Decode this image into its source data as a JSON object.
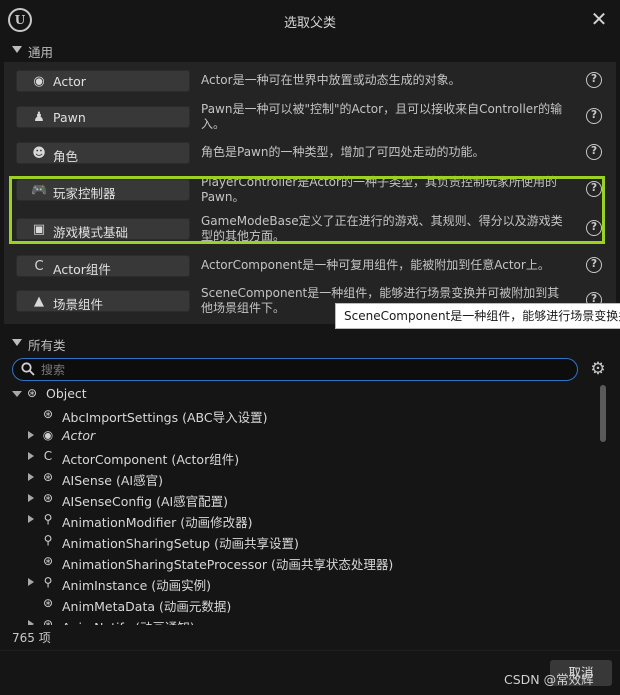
{
  "window": {
    "title": "选取父类",
    "close_glyph": "✕"
  },
  "common": {
    "header": "通用",
    "items": [
      {
        "icon": "actor-icon",
        "label": "Actor",
        "desc": "Actor是一种可在世界中放置或动态生成的对象。"
      },
      {
        "icon": "pawn-icon",
        "label": "Pawn",
        "desc": "Pawn是一种可以被\"控制\"的Actor，且可以接收来自Controller的输入。"
      },
      {
        "icon": "character-icon",
        "label": "角色",
        "desc": "角色是Pawn的一种类型，增加了可四处走动的功能。"
      },
      {
        "icon": "gamepad-icon",
        "label": "玩家控制器",
        "desc": "PlayerController是Actor的一种子类型，其负责控制玩家所使用的Pawn。"
      },
      {
        "icon": "game-mode-icon",
        "label": "游戏模式基础",
        "desc": "GameModeBase定义了正在进行的游戏、其规则、得分以及游戏类型的其他方面。"
      },
      {
        "icon": "component-icon",
        "label": "Actor组件",
        "desc": "ActorComponent是一种可复用组件，能被附加到任意Actor上。"
      },
      {
        "icon": "scene-component-icon",
        "label": "场景组件",
        "desc": "SceneComponent是一种组件，能够进行场景变换并可被附加到其他场景组件下。"
      }
    ]
  },
  "tooltip": {
    "text": "SceneComponent是一种组件，能够进行场景变换并可被附加到其他场景组件下。"
  },
  "all_classes": {
    "header": "所有类",
    "search_placeholder": "搜索",
    "tree": [
      {
        "label": "Object",
        "icon": "object-icon",
        "expanded": true,
        "has_children": true,
        "italic": false
      },
      {
        "label": "AbcImportSettings (ABC导入设置)",
        "icon": "object-icon",
        "has_children": false,
        "italic": false
      },
      {
        "label": "Actor",
        "icon": "actor-icon",
        "has_children": true,
        "italic": true
      },
      {
        "label": "ActorComponent (Actor组件)",
        "icon": "component-icon",
        "has_children": true,
        "italic": false
      },
      {
        "label": "AISense (AI感官)",
        "icon": "object-icon",
        "has_children": true,
        "italic": false
      },
      {
        "label": "AISenseConfig (AI感官配置)",
        "icon": "object-icon",
        "has_children": true,
        "italic": false
      },
      {
        "label": "AnimationModifier (动画修改器)",
        "icon": "running-icon",
        "has_children": true,
        "italic": false
      },
      {
        "label": "AnimationSharingSetup (动画共享设置)",
        "icon": "running-icon",
        "has_children": false,
        "italic": false
      },
      {
        "label": "AnimationSharingStateProcessor (动画共享状态处理器)",
        "icon": "object-icon",
        "has_children": false,
        "italic": false
      },
      {
        "label": "AnimInstance (动画实例)",
        "icon": "running-icon",
        "has_children": true,
        "italic": false
      },
      {
        "label": "AnimMetaData (动画元数据)",
        "icon": "object-icon",
        "has_children": false,
        "italic": false
      },
      {
        "label": "AnimNotify (动画通知)",
        "icon": "object-icon",
        "has_children": true,
        "italic": false
      }
    ],
    "count": "765 项"
  },
  "footer": {
    "cancel": "取消",
    "watermark": "CSDN @常效辉"
  },
  "colors": {
    "highlight": "#9bd122",
    "search_border": "#2f73c9",
    "background": "#151515",
    "panel": "#242424",
    "button": "#383838"
  }
}
